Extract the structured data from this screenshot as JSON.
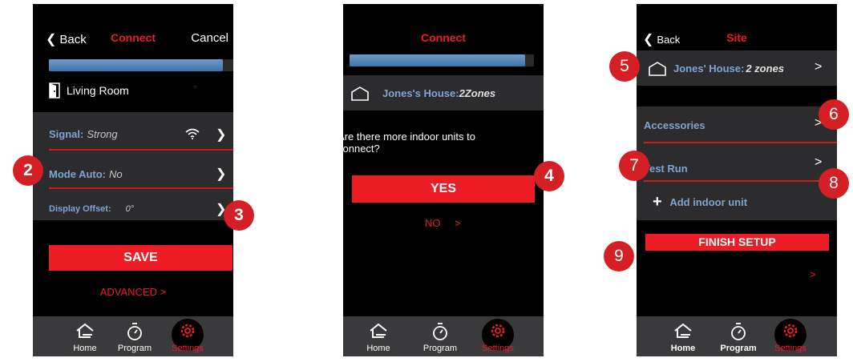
{
  "screen1": {
    "back": "Back",
    "title": "Connect",
    "cancel": "Cancel",
    "progress": 0.95,
    "room": "Living Room",
    "signal_label": "Signal:",
    "signal_value": "Strong",
    "mode_label": "Mode Auto:",
    "mode_value": "No",
    "offset_label": "Display Offset:",
    "offset_value": "0°",
    "save": "SAVE",
    "advanced": "ADVANCED >"
  },
  "screen2": {
    "title": "Connect",
    "progress": 0.95,
    "house": "Jones's House:",
    "zones": "2Zones",
    "question": "Are there more indoor units to connect?",
    "yes": "YES",
    "no": "NO",
    "no_chev": ">"
  },
  "screen3": {
    "back": "Back",
    "title": "Site",
    "house": "Jones' House:",
    "zones": "2 zones",
    "accessories": "Accessories",
    "test_run": "Test Run",
    "add_unit": "Add indoor unit",
    "finish": "FINISH SETUP",
    "chev": ">"
  },
  "tabs": {
    "home": "Home",
    "program": "Program",
    "settings": "Settings"
  },
  "badges": [
    "2",
    "3",
    "4",
    "5",
    "6",
    "7",
    "8",
    "9"
  ],
  "colors": {
    "accent_red": "#ee1c24",
    "label_blue": "#7fa5cf",
    "panel": "#2c2c2f"
  }
}
